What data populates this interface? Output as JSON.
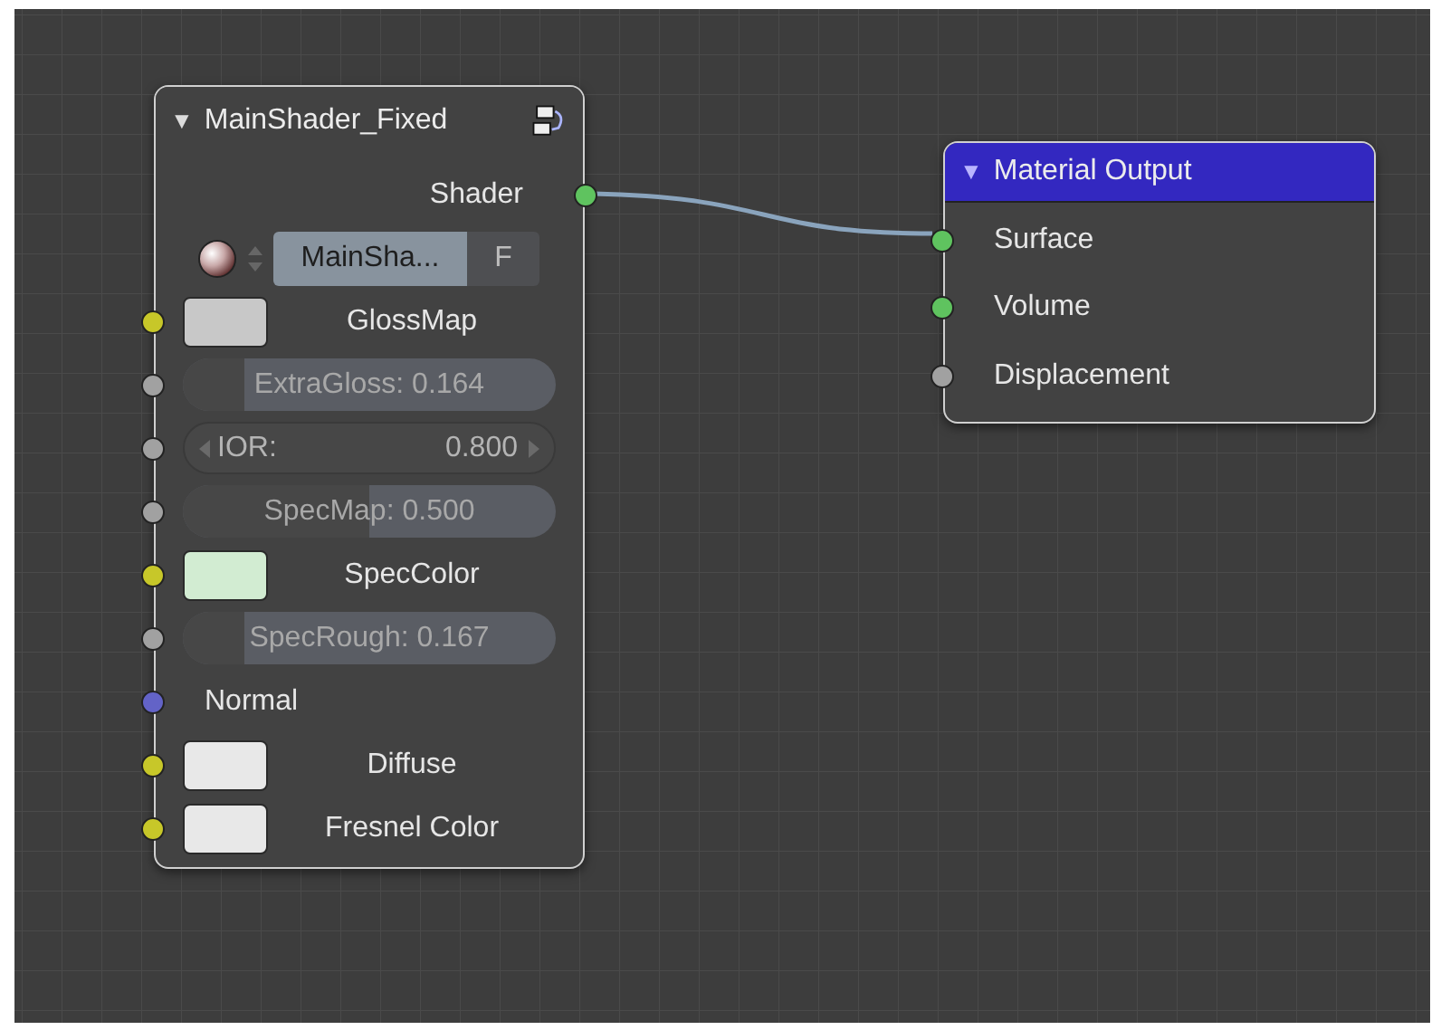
{
  "nodes": [
    {
      "kind": "group",
      "toggle": "▼",
      "title": "MainShader_Fixed",
      "rows": [
        {
          "kind": "output",
          "label": "Shader",
          "socket": {
            "color": "#5fc35f"
          }
        },
        {
          "kind": "datablock",
          "name": "MainSha...",
          "fake_user": "F"
        },
        {
          "kind": "color",
          "label": "GlossMap",
          "socket": {
            "color": "#c7c729"
          },
          "swatch": {
            "color": "#c8c8c8"
          }
        },
        {
          "kind": "slider",
          "label": "ExtraGloss:",
          "value": "0.164",
          "level": 0.164,
          "socket": {
            "color": "#a1a1a1"
          }
        },
        {
          "kind": "number",
          "label": "IOR:",
          "value": "0.800",
          "socket": {
            "color": "#a1a1a1"
          }
        },
        {
          "kind": "slider",
          "label": "SpecMap:",
          "value": "0.500",
          "level": 0.5,
          "socket": {
            "color": "#a1a1a1"
          }
        },
        {
          "kind": "color",
          "label": "SpecColor",
          "socket": {
            "color": "#c7c729"
          },
          "swatch": {
            "color": "#d2ecd2"
          }
        },
        {
          "kind": "slider",
          "label": "SpecRough:",
          "value": "0.167",
          "level": 0.167,
          "socket": {
            "color": "#a1a1a1"
          }
        },
        {
          "kind": "input",
          "label": "Normal",
          "socket": {
            "color": "#6363c7"
          }
        },
        {
          "kind": "color",
          "label": "Diffuse",
          "socket": {
            "color": "#c7c729"
          },
          "swatch": {
            "color": "#e8e8e8"
          }
        },
        {
          "kind": "color",
          "label": "Fresnel Color",
          "socket": {
            "color": "#c7c729"
          },
          "swatch": {
            "color": "#e8e8e8"
          }
        }
      ]
    },
    {
      "kind": "output",
      "toggle": "▼",
      "title": "Material Output",
      "rows": [
        {
          "kind": "input",
          "label": "Surface",
          "socket": {
            "color": "#5fc35f"
          }
        },
        {
          "kind": "input",
          "label": "Volume",
          "socket": {
            "color": "#5fc35f"
          }
        },
        {
          "kind": "input",
          "label": "Displacement",
          "socket": {
            "color": "#a1a1a1"
          }
        }
      ]
    }
  ]
}
